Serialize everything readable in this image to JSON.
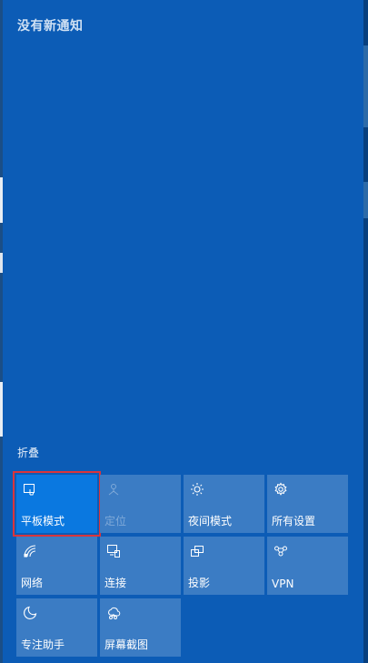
{
  "header": {
    "title": "没有新通知"
  },
  "collapse_label": "折叠",
  "tiles": [
    {
      "label": "平板模式",
      "icon": "tablet-mode-icon",
      "state": "active"
    },
    {
      "label": "定位",
      "icon": "location-icon",
      "state": "disabled"
    },
    {
      "label": "夜间模式",
      "icon": "brightness-icon",
      "state": "normal"
    },
    {
      "label": "所有设置",
      "icon": "gear-icon",
      "state": "normal"
    },
    {
      "label": "网络",
      "icon": "network-icon",
      "state": "normal"
    },
    {
      "label": "连接",
      "icon": "connect-icon",
      "state": "normal"
    },
    {
      "label": "投影",
      "icon": "project-icon",
      "state": "normal"
    },
    {
      "label": "VPN",
      "icon": "vpn-icon",
      "state": "normal"
    },
    {
      "label": "专注助手",
      "icon": "moon-icon",
      "state": "normal"
    },
    {
      "label": "屏幕截图",
      "icon": "screen-snip-icon",
      "state": "normal"
    }
  ],
  "colors": {
    "panel_bg": "#0c5cb6",
    "tile_bg": "#3b7cc4",
    "tile_active_bg": "#0a78e0",
    "highlight_border": "#d9353c",
    "disabled_text": "#7fa9d8"
  }
}
